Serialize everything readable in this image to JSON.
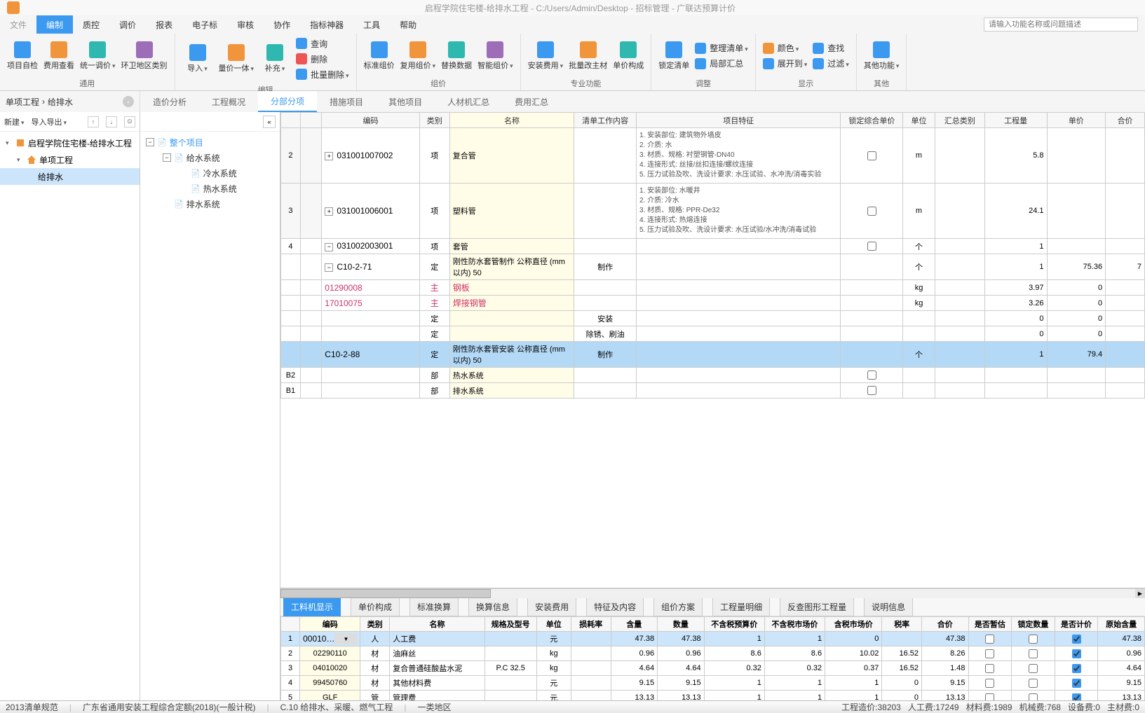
{
  "titlebar": {
    "title": "启程学院住宅楼-给排水工程 - C:/Users/Admin/Desktop - 招标管理 - 广联达预算计价"
  },
  "menu": {
    "file": "文件",
    "tabs": [
      "编制",
      "质控",
      "调价",
      "报表",
      "电子标",
      "审核",
      "协作",
      "指标神器",
      "工具",
      "帮助"
    ],
    "search_placeholder": "请输入功能名称或问题描述"
  },
  "ribbon": {
    "groups": [
      {
        "label": "通用",
        "big": [
          {
            "label": "项目自检"
          },
          {
            "label": "费用查看"
          },
          {
            "label": "统一调价",
            "dd": true
          },
          {
            "label": "环卫地区类别"
          }
        ]
      },
      {
        "label": "编辑",
        "big": [
          {
            "label": "导入",
            "dd": true
          },
          {
            "label": "量价一体",
            "dd": true
          },
          {
            "label": "补充",
            "dd": true
          }
        ],
        "col": [
          {
            "icon": "ico-blue",
            "label": "查询"
          },
          {
            "icon": "ico-red",
            "label": "删除"
          },
          {
            "icon": "ico-blue",
            "label": "批量删除",
            "dd": true
          }
        ]
      },
      {
        "label": "组价",
        "big": [
          {
            "label": "标准组价"
          },
          {
            "label": "复用组价",
            "dd": true
          },
          {
            "label": "替换数据"
          },
          {
            "label": "智能组价",
            "dd": true
          }
        ]
      },
      {
        "label": "专业功能",
        "big": [
          {
            "label": "安装费用",
            "dd": true
          },
          {
            "label": "批量改主材"
          },
          {
            "label": "单价构成"
          }
        ]
      },
      {
        "label": "调整",
        "big": [
          {
            "label": "锁定清单"
          }
        ],
        "col": [
          {
            "icon": "ico-blue",
            "label": "整理清单",
            "dd": true
          },
          {
            "icon": "ico-blue",
            "label": "局部汇总"
          }
        ]
      },
      {
        "label": "显示",
        "col2": [
          [
            {
              "icon": "ico-orange",
              "label": "颜色",
              "dd": true
            },
            {
              "icon": "ico-blue",
              "label": "展开到",
              "dd": true
            }
          ],
          [
            {
              "icon": "ico-blue",
              "label": "查找"
            },
            {
              "icon": "ico-blue",
              "label": "过滤",
              "dd": true
            }
          ]
        ]
      },
      {
        "label": "其他",
        "big": [
          {
            "label": "其他功能",
            "dd": true
          }
        ]
      }
    ]
  },
  "breadcrumb": {
    "a": "单项工程",
    "b": "给排水"
  },
  "subtabs": [
    "造价分析",
    "工程概况",
    "分部分项",
    "措施项目",
    "其他项目",
    "人材机汇总",
    "费用汇总"
  ],
  "subtab_active": 2,
  "left_toolbar": {
    "new": "新建",
    "import_export": "导入导出"
  },
  "nav_tree": [
    {
      "label": "启程学院住宅楼-给排水工程",
      "level": 0,
      "icon": "building"
    },
    {
      "label": "单项工程",
      "level": 1,
      "icon": "home"
    },
    {
      "label": "给排水",
      "level": 2,
      "selected": true
    }
  ],
  "mid_tree": [
    {
      "expander": "−",
      "label": "整个项目",
      "indent": 0,
      "blue": true
    },
    {
      "expander": "−",
      "label": "给水系统",
      "indent": 1
    },
    {
      "label": "冷水系统",
      "indent": 2
    },
    {
      "label": "热水系统",
      "indent": 2
    },
    {
      "label": "排水系统",
      "indent": 1
    }
  ],
  "main_grid": {
    "headers": [
      "",
      "",
      "编码",
      "类别",
      "名称",
      "清单工作内容",
      "项目特征",
      "锁定综合单价",
      "单位",
      "汇总类别",
      "工程量",
      "单价",
      "合价"
    ],
    "rows": [
      {
        "no": "2",
        "code_expander": "+",
        "code": "031001007002",
        "kind": "项",
        "name": "复合管",
        "feat": "1. 安装部位: 建筑物外墙皮\n2. 介质: 水\n3. 材质、规格: 衬塑钢管-DN40\n4. 连接形式: 丝接/丝扣连接/螺纹连接\n5. 压力试验及吹、洗设计要求: 水压试验、水冲洗/消毒实验",
        "lock": "cb",
        "unit": "m",
        "qty": "5.8"
      },
      {
        "no": "3",
        "code_expander": "+",
        "code": "031001006001",
        "kind": "项",
        "name": "塑料管",
        "feat": "1. 安装部位: 水暖井\n2. 介质: 冷水\n3. 材质、规格: PPR-De32\n4. 连接形式: 热熔连接\n5. 压力试验及吹、洗设计要求: 水压试验/水冲洗/消毒试验",
        "lock": "cb",
        "unit": "m",
        "qty": "24.1"
      },
      {
        "no": "4",
        "code_expander": "−",
        "code": "031002003001",
        "kind": "项",
        "name": "套管",
        "lock": "cb",
        "unit": "个",
        "qty": "1"
      },
      {
        "code_expander": "−",
        "code": "C10-2-71",
        "kind": "定",
        "name": "刚性防水套管制作  公称直径 (mm以内) 50",
        "work": "制作",
        "unit": "个",
        "qty": "1",
        "price": "75.36",
        "total": "7"
      },
      {
        "code": "01290008",
        "kind": "主",
        "name": "钢板",
        "pink": true,
        "unit": "kg",
        "qty": "3.97",
        "price": "0"
      },
      {
        "code": "17010075",
        "kind": "主",
        "name": "焊接钢管",
        "pink": true,
        "unit": "kg",
        "qty": "3.26",
        "price": "0"
      },
      {
        "kind": "定",
        "work": "安装",
        "qty": "0",
        "price": "0"
      },
      {
        "kind": "定",
        "work": "除锈、刷油",
        "qty": "0",
        "price": "0"
      },
      {
        "sel": true,
        "code": "C10-2-88",
        "kind": "定",
        "name": "刚性防水套管安装  公称直径 (mm以内) 50",
        "work": "制作",
        "unit": "个",
        "qty": "1",
        "price": "79.4"
      },
      {
        "no": "B2",
        "kind": "部",
        "name": "热水系统",
        "lock": "cb"
      },
      {
        "no": "B1",
        "kind": "部",
        "name": "排水系统",
        "lock": "cb"
      }
    ]
  },
  "bottom_tabs": [
    "工料机显示",
    "单价构成",
    "标准换算",
    "换算信息",
    "安装费用",
    "特征及内容",
    "组价方案",
    "工程量明细",
    "反查图形工程量",
    "说明信息"
  ],
  "btm_grid": {
    "headers": [
      "",
      "编码",
      "类别",
      "名称",
      "规格及型号",
      "单位",
      "损耗率",
      "含量",
      "数量",
      "不含税预算价",
      "不含税市场价",
      "含税市场价",
      "税率",
      "合价",
      "是否暂估",
      "锁定数量",
      "是否计价",
      "原始含量"
    ],
    "rows": [
      {
        "sel": true,
        "rn": "1",
        "code": "00010…",
        "dd": true,
        "kind": "人",
        "name": "人工费",
        "unit": "元",
        "qty": "47.38",
        "num": "47.38",
        "bp": "1",
        "mp": "1",
        "tp": "0",
        "sum": "47.38",
        "tmp": false,
        "lock": false,
        "pr": true,
        "orig": "47.38"
      },
      {
        "rn": "2",
        "code": "02290110",
        "kind": "材",
        "name": "油麻丝",
        "unit": "kg",
        "qty": "0.96",
        "num": "0.96",
        "bp": "8.6",
        "mp": "8.6",
        "tp": "10.02",
        "tax": "16.52",
        "sum": "8.26",
        "tmp": false,
        "lock": false,
        "pr": true,
        "orig": "0.96"
      },
      {
        "rn": "3",
        "code": "04010020",
        "kind": "材",
        "name": "复合普通硅酸盐水泥",
        "spec": "P.C 32.5",
        "unit": "kg",
        "qty": "4.64",
        "num": "4.64",
        "bp": "0.32",
        "mp": "0.32",
        "tp": "0.37",
        "tax": "16.52",
        "sum": "1.48",
        "tmp": false,
        "lock": false,
        "pr": true,
        "orig": "4.64"
      },
      {
        "rn": "4",
        "code": "99450760",
        "kind": "材",
        "name": "其他材料费",
        "unit": "元",
        "qty": "9.15",
        "num": "9.15",
        "bp": "1",
        "mp": "1",
        "tp": "1",
        "tax": "0",
        "sum": "9.15",
        "tmp": false,
        "lock": false,
        "pr": true,
        "orig": "9.15"
      },
      {
        "rn": "5",
        "code": "GLF",
        "kind": "管",
        "name": "管理费",
        "unit": "元",
        "qty": "13.13",
        "num": "13.13",
        "bp": "1",
        "mp": "1",
        "tp": "1",
        "tax": "0",
        "sum": "13.13",
        "tmp": false,
        "lock": false,
        "pr": true,
        "orig": "13.13"
      }
    ]
  },
  "status": {
    "a": "2013清单规范",
    "b": "广东省通用安装工程综合定额(2018)(一般计税)",
    "c": "C.10 给排水、采暖、燃气工程",
    "d": "一类地区",
    "r1": "工程造价:38203",
    "r2": "人工费:17249",
    "r3": "材料费:1989",
    "r4": "机械费:768",
    "r5": "设备费:0",
    "r6": "主材费:0"
  }
}
